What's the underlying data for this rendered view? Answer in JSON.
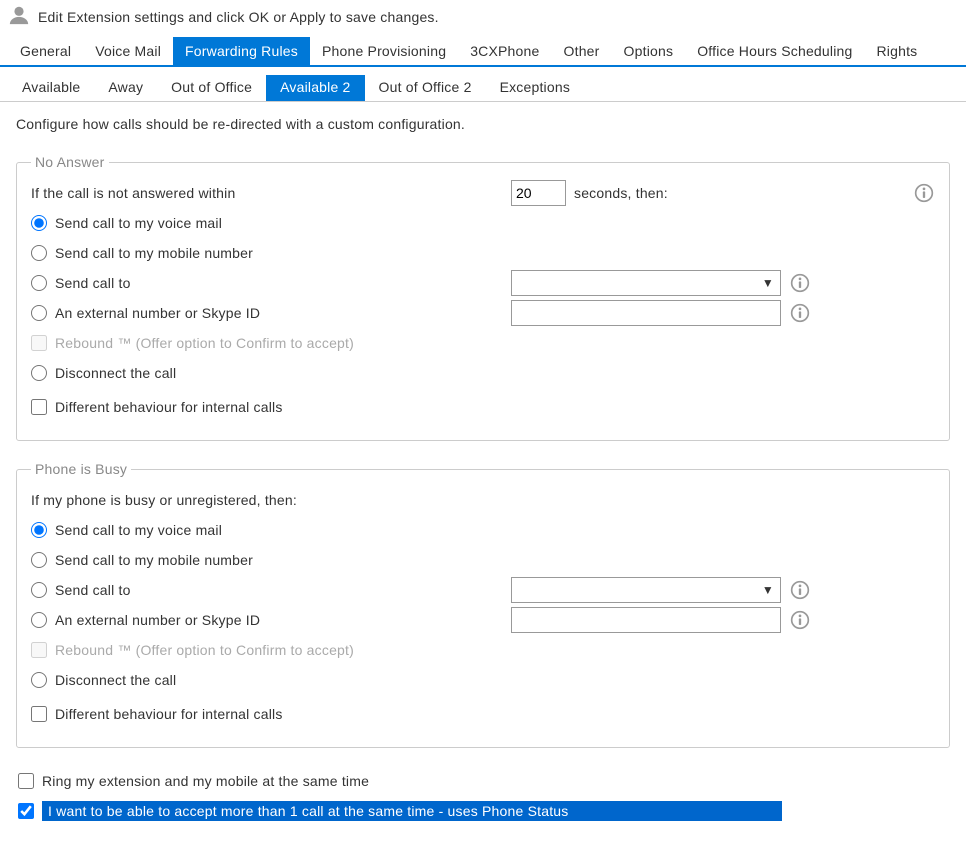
{
  "header": {
    "instruction": "Edit Extension settings and click OK or Apply to save changes."
  },
  "main_tabs": [
    {
      "label": "General",
      "active": false
    },
    {
      "label": "Voice Mail",
      "active": false
    },
    {
      "label": "Forwarding Rules",
      "active": true
    },
    {
      "label": "Phone Provisioning",
      "active": false
    },
    {
      "label": "3CXPhone",
      "active": false
    },
    {
      "label": "Other",
      "active": false
    },
    {
      "label": "Options",
      "active": false
    },
    {
      "label": "Office Hours Scheduling",
      "active": false
    },
    {
      "label": "Rights",
      "active": false
    }
  ],
  "sub_tabs": [
    {
      "label": "Available",
      "active": false
    },
    {
      "label": "Away",
      "active": false
    },
    {
      "label": "Out of Office",
      "active": false
    },
    {
      "label": "Available 2",
      "active": true
    },
    {
      "label": "Out of Office 2",
      "active": false
    },
    {
      "label": "Exceptions",
      "active": false
    }
  ],
  "description": "Configure how calls should be re-directed with a custom configuration.",
  "no_answer": {
    "legend": "No Answer",
    "prompt": "If the call is not answered within",
    "seconds_value": "20",
    "seconds_label": "seconds, then:",
    "options": {
      "voicemail": "Send call to my voice mail",
      "mobile": "Send call to my mobile number",
      "sendto": "Send call to",
      "external": "An external number or Skype ID",
      "rebound": "Rebound ™ (Offer option to Confirm to accept)",
      "disconnect": "Disconnect the call",
      "different_internal": "Different behaviour for internal calls"
    },
    "selected": "voicemail"
  },
  "busy": {
    "legend": "Phone is Busy",
    "prompt": "If my phone is busy or unregistered, then:",
    "options": {
      "voicemail": "Send call to my voice mail",
      "mobile": "Send call to my mobile number",
      "sendto": "Send call to",
      "external": "An external number or Skype ID",
      "rebound": "Rebound ™ (Offer option to Confirm to accept)",
      "disconnect": "Disconnect the call",
      "different_internal": "Different behaviour for internal calls"
    },
    "selected": "voicemail"
  },
  "bottom": {
    "ring_both": "Ring my extension and my mobile at the same time",
    "multi_call": "I want to be able to accept more than 1 call at the same time - uses Phone Status"
  }
}
